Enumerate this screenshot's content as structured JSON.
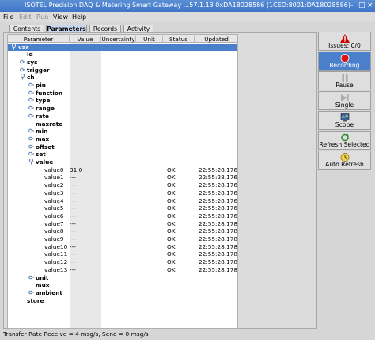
{
  "window": {
    "title": "ISOTEL Precision DAQ & Metering Smart Gateway ...57.1.13 0xDA18028586 (1CED:8001:DA18028586)",
    "controls": [
      "–",
      "□",
      "×"
    ]
  },
  "menu": {
    "items": [
      {
        "label": "File",
        "enabled": true
      },
      {
        "label": "Edit",
        "enabled": false
      },
      {
        "label": "Run",
        "enabled": false
      },
      {
        "label": "View",
        "enabled": true
      },
      {
        "label": "Help",
        "enabled": true
      }
    ]
  },
  "tabs": [
    {
      "label": "Contents",
      "active": false
    },
    {
      "label": "Parameters",
      "active": true
    },
    {
      "label": "Records",
      "active": false
    },
    {
      "label": "Activity",
      "active": false
    }
  ],
  "table": {
    "columns": [
      "Parameter",
      "Value",
      "Uncertainty",
      "Unit",
      "Status",
      "Updated"
    ],
    "rows": [
      {
        "name": "var",
        "indent": 0,
        "expander": "open",
        "bold": true,
        "selected": true,
        "value": "",
        "status": "",
        "updated": ""
      },
      {
        "name": "id",
        "indent": 1,
        "expander": "",
        "bold": true,
        "value": "",
        "status": "",
        "updated": ""
      },
      {
        "name": "sys",
        "indent": 1,
        "expander": "closed",
        "bold": true,
        "value": "",
        "status": "",
        "updated": ""
      },
      {
        "name": "trigger",
        "indent": 1,
        "expander": "closed",
        "bold": true,
        "value": "",
        "status": "",
        "updated": ""
      },
      {
        "name": "ch",
        "indent": 1,
        "expander": "open",
        "bold": true,
        "value": "",
        "status": "",
        "updated": ""
      },
      {
        "name": "pin",
        "indent": 2,
        "expander": "closed",
        "bold": true,
        "value": "",
        "status": "",
        "updated": ""
      },
      {
        "name": "function",
        "indent": 2,
        "expander": "closed",
        "bold": true,
        "value": "",
        "status": "",
        "updated": ""
      },
      {
        "name": "type",
        "indent": 2,
        "expander": "closed",
        "bold": true,
        "value": "",
        "status": "",
        "updated": ""
      },
      {
        "name": "range",
        "indent": 2,
        "expander": "closed",
        "bold": true,
        "value": "",
        "status": "",
        "updated": ""
      },
      {
        "name": "rate",
        "indent": 2,
        "expander": "closed",
        "bold": true,
        "value": "",
        "status": "",
        "updated": ""
      },
      {
        "name": "maxrate",
        "indent": 2,
        "expander": "",
        "bold": true,
        "value": "",
        "status": "",
        "updated": ""
      },
      {
        "name": "min",
        "indent": 2,
        "expander": "closed",
        "bold": true,
        "value": "",
        "status": "",
        "updated": ""
      },
      {
        "name": "max",
        "indent": 2,
        "expander": "closed",
        "bold": true,
        "value": "",
        "status": "",
        "updated": ""
      },
      {
        "name": "offset",
        "indent": 2,
        "expander": "closed",
        "bold": true,
        "value": "",
        "status": "",
        "updated": ""
      },
      {
        "name": "set",
        "indent": 2,
        "expander": "closed",
        "bold": true,
        "value": "",
        "status": "",
        "updated": ""
      },
      {
        "name": "value",
        "indent": 2,
        "expander": "open",
        "bold": true,
        "value": "",
        "status": "",
        "updated": ""
      },
      {
        "name": "value0",
        "indent": 3,
        "expander": "",
        "bold": false,
        "value": "31.0",
        "status": "OK",
        "updated": "22:55:28.176"
      },
      {
        "name": "value1",
        "indent": 3,
        "expander": "",
        "bold": false,
        "value": "---",
        "status": "OK",
        "updated": "22:55:28.176"
      },
      {
        "name": "value2",
        "indent": 3,
        "expander": "",
        "bold": false,
        "value": "---",
        "status": "OK",
        "updated": "22:55:28.176"
      },
      {
        "name": "value3",
        "indent": 3,
        "expander": "",
        "bold": false,
        "value": "---",
        "status": "OK",
        "updated": "22:55:28.176"
      },
      {
        "name": "value4",
        "indent": 3,
        "expander": "",
        "bold": false,
        "value": "---",
        "status": "OK",
        "updated": "22:55:28.176"
      },
      {
        "name": "value5",
        "indent": 3,
        "expander": "",
        "bold": false,
        "value": "---",
        "status": "OK",
        "updated": "22:55:28.176"
      },
      {
        "name": "value6",
        "indent": 3,
        "expander": "",
        "bold": false,
        "value": "---",
        "status": "OK",
        "updated": "22:55:28.176"
      },
      {
        "name": "value7",
        "indent": 3,
        "expander": "",
        "bold": false,
        "value": "---",
        "status": "OK",
        "updated": "22:55:28.178"
      },
      {
        "name": "value8",
        "indent": 3,
        "expander": "",
        "bold": false,
        "value": "---",
        "status": "OK",
        "updated": "22:55:28.178"
      },
      {
        "name": "value9",
        "indent": 3,
        "expander": "",
        "bold": false,
        "value": "---",
        "status": "OK",
        "updated": "22:55:28.178"
      },
      {
        "name": "value10",
        "indent": 3,
        "expander": "",
        "bold": false,
        "value": "---",
        "status": "OK",
        "updated": "22:55:28.178"
      },
      {
        "name": "value11",
        "indent": 3,
        "expander": "",
        "bold": false,
        "value": "---",
        "status": "OK",
        "updated": "22:55:28.178"
      },
      {
        "name": "value12",
        "indent": 3,
        "expander": "",
        "bold": false,
        "value": "---",
        "status": "OK",
        "updated": "22:55:28.178"
      },
      {
        "name": "value13",
        "indent": 3,
        "expander": "",
        "bold": false,
        "value": "---",
        "status": "OK",
        "updated": "22:55:28.178"
      },
      {
        "name": "unit",
        "indent": 2,
        "expander": "closed",
        "bold": true,
        "value": "",
        "status": "",
        "updated": ""
      },
      {
        "name": "mux",
        "indent": 2,
        "expander": "",
        "bold": true,
        "value": "",
        "status": "",
        "updated": ""
      },
      {
        "name": "ambient",
        "indent": 2,
        "expander": "closed",
        "bold": true,
        "value": "",
        "status": "",
        "updated": ""
      },
      {
        "name": "store",
        "indent": 1,
        "expander": "",
        "bold": true,
        "value": "",
        "status": "",
        "updated": ""
      }
    ]
  },
  "side_buttons": [
    {
      "label": "Issues: 0/0",
      "icon": "warning-icon",
      "color": "#cc0000",
      "active": false
    },
    {
      "label": "Recording",
      "icon": "record-icon",
      "color": "#dd1111",
      "active": true
    },
    {
      "label": "Pause",
      "icon": "pause-icon",
      "color": "#555555",
      "active": false
    },
    {
      "label": "Single",
      "icon": "single-step-icon",
      "color": "#555555",
      "active": false
    },
    {
      "label": "Scope",
      "icon": "scope-icon",
      "color": "#3a5f9a",
      "active": false
    },
    {
      "label": "Refresh Selected",
      "icon": "refresh-icon",
      "color": "#2a8a2a",
      "active": false
    },
    {
      "label": "Auto Refresh",
      "icon": "clock-icon",
      "color": "#c8a000",
      "active": false
    }
  ],
  "status_bar": {
    "text": "Transfer Rate Receive = 4 msg/s, Send = 0 msg/s"
  },
  "colors": {
    "selection": "#4a7fcc",
    "titlebar": "#4a80cc"
  }
}
